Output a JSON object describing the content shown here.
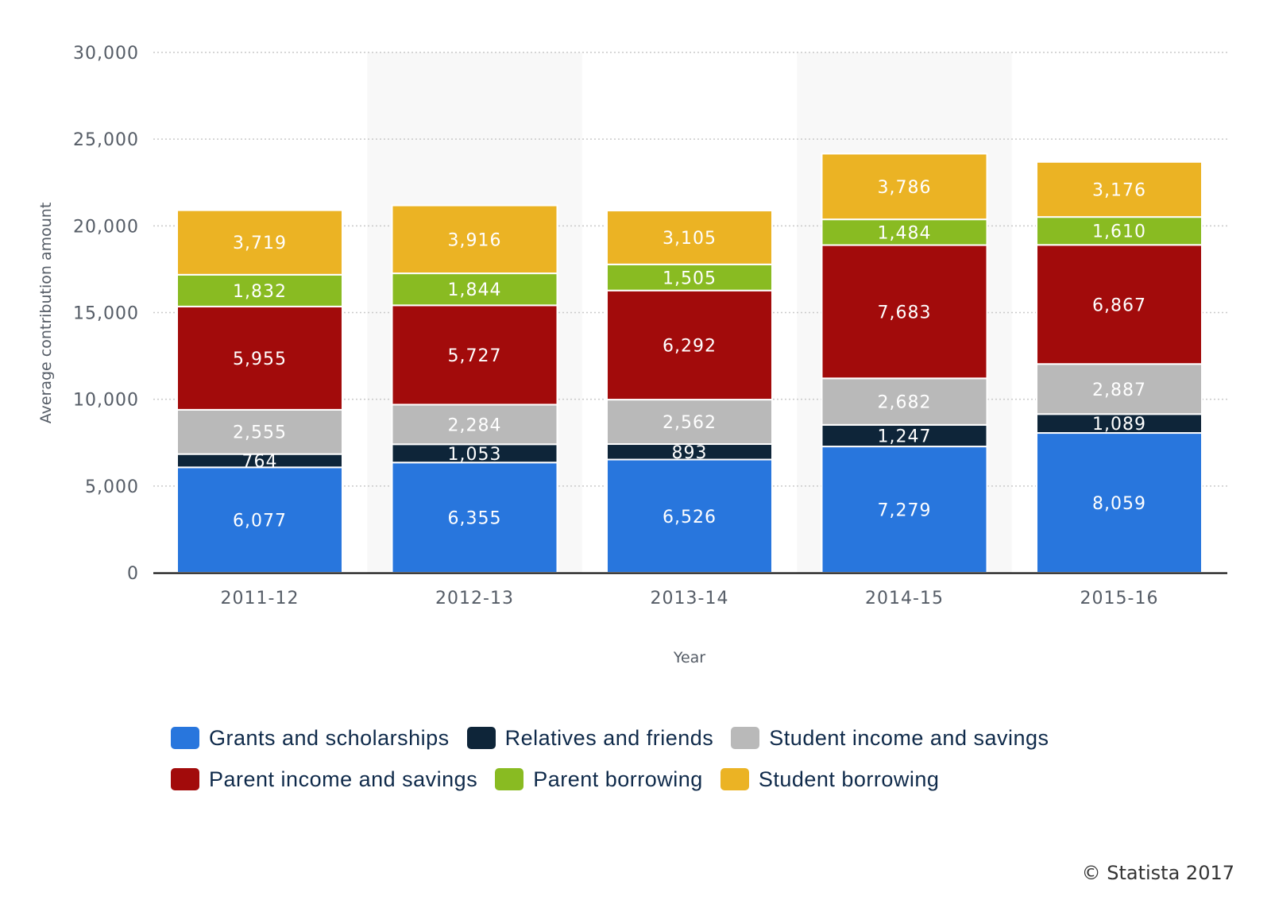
{
  "chart_data": {
    "type": "bar",
    "stacked": true,
    "title": "",
    "xlabel": "Year",
    "ylabel": "Average contribution amount",
    "ylim": [
      0,
      30000
    ],
    "yticks": [
      0,
      5000,
      10000,
      15000,
      20000,
      25000,
      30000
    ],
    "ytick_labels": [
      "0",
      "5,000",
      "10,000",
      "15,000",
      "20,000",
      "25,000",
      "30,000"
    ],
    "grid": true,
    "legend_position": "bottom",
    "categories": [
      "2011-12",
      "2012-13",
      "2013-14",
      "2014-15",
      "2015-16"
    ],
    "series": [
      {
        "name": "Grants and scholarships",
        "color": "#2876dd",
        "values": [
          6077,
          6355,
          6526,
          7279,
          8059
        ],
        "labels": [
          "6,077",
          "6,355",
          "6,526",
          "7,279",
          "8,059"
        ]
      },
      {
        "name": "Relatives and friends",
        "color": "#0e2539",
        "values": [
          764,
          1053,
          893,
          1247,
          1089
        ],
        "labels": [
          "764",
          "1,053",
          "893",
          "1,247",
          "1,089"
        ]
      },
      {
        "name": "Student income and savings",
        "color": "#b9b9b9",
        "values": [
          2555,
          2284,
          2562,
          2682,
          2887
        ],
        "labels": [
          "2,555",
          "2,284",
          "2,562",
          "2,682",
          "2,887"
        ]
      },
      {
        "name": "Parent income and savings",
        "color": "#a20b0b",
        "values": [
          5955,
          5727,
          6292,
          7683,
          6867
        ],
        "labels": [
          "5,955",
          "5,727",
          "6,292",
          "7,683",
          "6,867"
        ]
      },
      {
        "name": "Parent borrowing",
        "color": "#89bb22",
        "values": [
          1832,
          1844,
          1505,
          1484,
          1610
        ],
        "labels": [
          "1,832",
          "1,844",
          "1,505",
          "1,484",
          "1,610"
        ]
      },
      {
        "name": "Student borrowing",
        "color": "#ebb324",
        "values": [
          3719,
          3916,
          3105,
          3786,
          3176
        ],
        "labels": [
          "3,719",
          "3,916",
          "3,105",
          "3,786",
          "3,176"
        ]
      }
    ]
  },
  "legend": {
    "row1": [
      {
        "label": "Grants and scholarships",
        "color": "#2876dd"
      },
      {
        "label": "Relatives and friends",
        "color": "#0e2539"
      },
      {
        "label": "Student income and savings",
        "color": "#b9b9b9"
      }
    ],
    "row2": [
      {
        "label": "Parent income and savings",
        "color": "#a20b0b"
      },
      {
        "label": "Parent borrowing",
        "color": "#89bb22"
      },
      {
        "label": "Student borrowing",
        "color": "#ebb324"
      }
    ]
  },
  "credit": "© Statista 2017"
}
